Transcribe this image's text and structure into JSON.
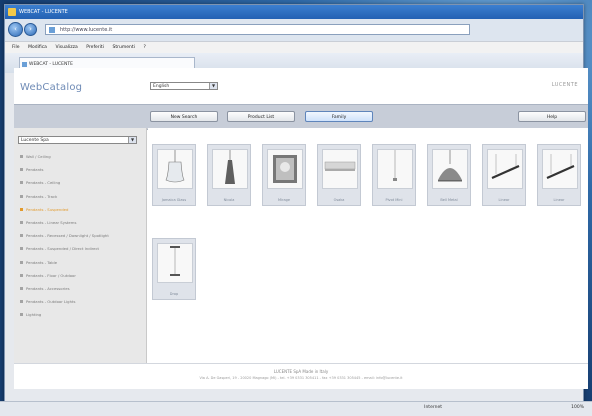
{
  "window": {
    "title": "WEBCAT - LUCENTE"
  },
  "browser": {
    "address": "http://www.lucente.it",
    "menu": [
      "File",
      "Modifica",
      "Visualizza",
      "Preferiti",
      "Strumenti",
      "?"
    ],
    "tab_title": "WEBCAT - LUCENTE"
  },
  "header": {
    "logo": "WebCatalog",
    "language": "English",
    "brand": "LUCENTE"
  },
  "toolbar": {
    "buttons": [
      "New Search",
      "Product List",
      "Family",
      "Help"
    ]
  },
  "sidebar": {
    "category_select": "Lucente Spa",
    "categories": [
      "Wall / Ceiling",
      "Pendants",
      "Pendants - Ceiling",
      "Pendants - Track",
      "Pendants - Suspended",
      "Pendants - Linear Systems",
      "Pendants - Recessed / Downlight / Spotlight",
      "Pendants - Suspended / Direct Indirect",
      "Pendants - Table",
      "Pendants - Floor / Outdoor",
      "Pendants - Accessories",
      "Pendants - Outdoor Lights",
      "Lighting"
    ],
    "selected_index": 4
  },
  "products": [
    {
      "name": "Jamaica Glass",
      "thumb": "glass-pendant"
    },
    {
      "name": "Nicola",
      "thumb": "cone-pendant"
    },
    {
      "name": "Mirage",
      "thumb": "photo-frame"
    },
    {
      "name": "Osaka",
      "thumb": "long-shade"
    },
    {
      "name": "Pivot Mini",
      "thumb": "mini-pendant"
    },
    {
      "name": "Bell Metal",
      "thumb": "dome-pendant"
    },
    {
      "name": "Linear",
      "thumb": "linear-pendant"
    },
    {
      "name": "Linear",
      "thumb": "linear-pendant"
    },
    {
      "name": "Drop",
      "thumb": "mini-pendant"
    }
  ],
  "footer": {
    "company": "LUCENTE SpA Made in Italy",
    "address": "Via A. De Gasperi, 19 - 20020 Magnago (MI) - tel. +39 0331 305411 - fax +39 0331 305445 - email: info@lucente.it"
  },
  "status": {
    "state": "Internet",
    "zoom": "100%"
  }
}
